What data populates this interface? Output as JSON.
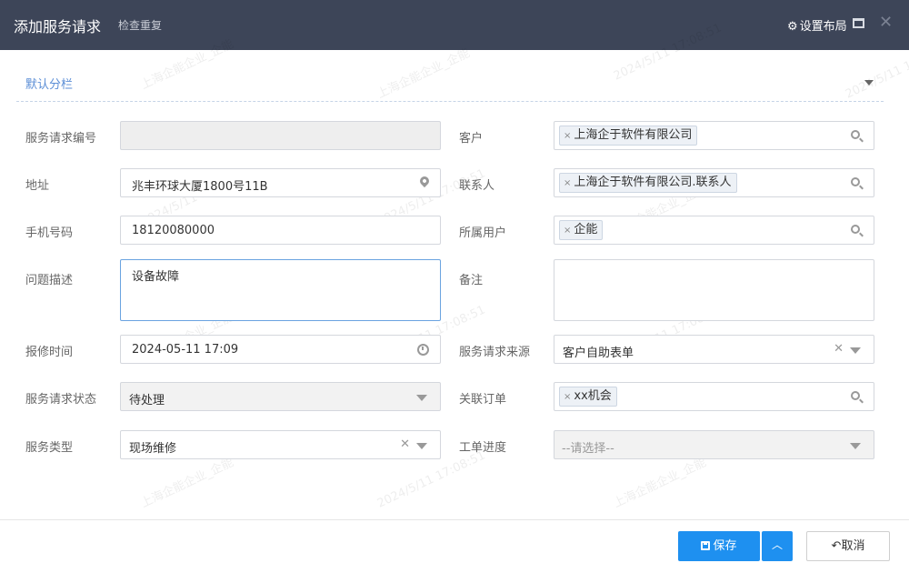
{
  "header": {
    "title": "添加服务请求",
    "check_duplicate": "检查重复",
    "layout_settings": "设置布局"
  },
  "section": {
    "title": "默认分栏"
  },
  "fields": {
    "service_request_no": {
      "label": "服务请求编号",
      "value": ""
    },
    "customer": {
      "label": "客户",
      "tags": [
        "上海企于软件有限公司"
      ]
    },
    "address": {
      "label": "地址",
      "value": "兆丰环球大厦1800号11B"
    },
    "contact": {
      "label": "联系人",
      "tags": [
        "上海企于软件有限公司.联系人"
      ]
    },
    "phone": {
      "label": "手机号码",
      "value": "18120080000"
    },
    "owner_user": {
      "label": "所属用户",
      "tags": [
        "企能"
      ]
    },
    "problem_desc": {
      "label": "问题描述",
      "value": "设备故障"
    },
    "remark": {
      "label": "备注",
      "value": ""
    },
    "report_time": {
      "label": "报修时间",
      "value": "2024-05-11 17:09"
    },
    "request_source": {
      "label": "服务请求来源",
      "value": "客户自助表单"
    },
    "request_status": {
      "label": "服务请求状态",
      "value": "待处理"
    },
    "related_order": {
      "label": "关联订单",
      "tags": [
        "xx机会"
      ]
    },
    "service_type": {
      "label": "服务类型",
      "value": "现场维修"
    },
    "work_progress": {
      "label": "工单进度",
      "placeholder": "--请选择--"
    }
  },
  "watermark": {
    "line1": "上海企能企业_企能",
    "line2": "2024/5/11 17:08:51"
  },
  "footer": {
    "save": "保存",
    "cancel": "取消"
  }
}
